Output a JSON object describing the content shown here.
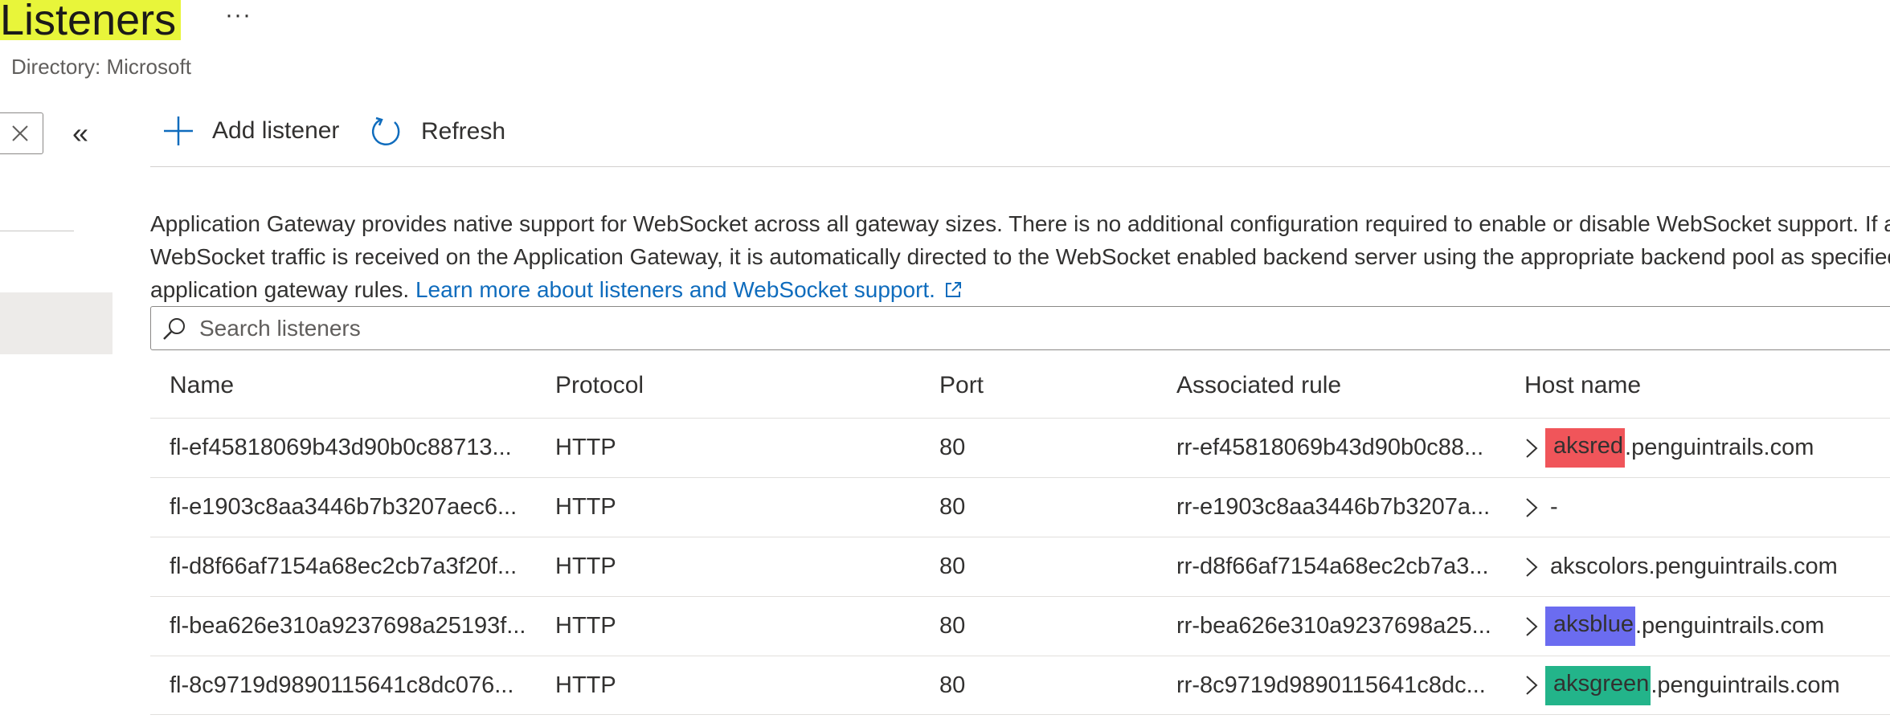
{
  "header": {
    "title": "Listeners",
    "more": "···",
    "subtitle": "Directory: Microsoft",
    "title_highlight": "#e8f53a"
  },
  "sidebar": {
    "close_icon": "close-icon",
    "collapse_icon": "double-chevron-left-icon",
    "collapse_glyph": "«"
  },
  "toolbar": {
    "add_label": "Add listener",
    "refresh_label": "Refresh"
  },
  "info": {
    "text": "Application Gateway provides native support for WebSocket across all gateway sizes. There is no additional configuration required to enable or disable WebSocket support. If a WebSocket traffic is received on the Application Gateway, it is automatically directed to the WebSocket enabled backend server using the appropriate backend pool as specified in application gateway rules.",
    "link": "Learn more about listeners and WebSocket support."
  },
  "search": {
    "placeholder": "Search listeners"
  },
  "table": {
    "columns": [
      "Name",
      "Protocol",
      "Port",
      "Associated rule",
      "Host name"
    ],
    "rows": [
      {
        "name": "fl-ef45818069b43d90b0c88713...",
        "protocol": "HTTP",
        "port": "80",
        "rule": "rr-ef45818069b43d90b0c88...",
        "host_prefix": "aksred",
        "host_suffix": ".penguintrails.com",
        "highlight": "#f0555a"
      },
      {
        "name": "fl-e1903c8aa3446b7b3207aec6...",
        "protocol": "HTTP",
        "port": "80",
        "rule": "rr-e1903c8aa3446b7b3207a...",
        "host_prefix": "-",
        "host_suffix": "",
        "highlight": ""
      },
      {
        "name": "fl-d8f66af7154a68ec2cb7a3f20f...",
        "protocol": "HTTP",
        "port": "80",
        "rule": "rr-d8f66af7154a68ec2cb7a3...",
        "host_prefix": "akscolors.penguintrails.com",
        "host_suffix": "",
        "highlight": ""
      },
      {
        "name": "fl-bea626e310a9237698a25193f...",
        "protocol": "HTTP",
        "port": "80",
        "rule": "rr-bea626e310a9237698a25...",
        "host_prefix": "aksblue",
        "host_suffix": ".penguintrails.com",
        "highlight": "#6b6cf0"
      },
      {
        "name": "fl-8c9719d9890115641c8dc076...",
        "protocol": "HTTP",
        "port": "80",
        "rule": "rr-8c9719d9890115641c8dc...",
        "host_prefix": "aksgreen",
        "host_suffix": ".penguintrails.com",
        "highlight": "#23b48a"
      }
    ]
  }
}
